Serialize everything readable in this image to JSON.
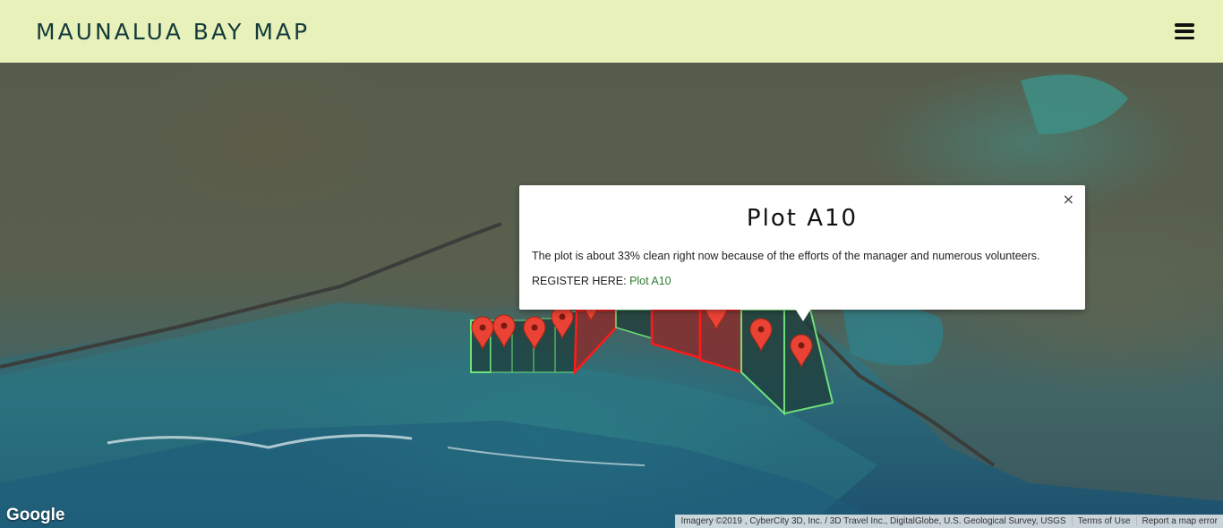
{
  "header": {
    "title": "MAUNALUA BAY MAP",
    "menu_icon": "hamburger-menu-icon"
  },
  "popup": {
    "title": "Plot A10",
    "close_symbol": "×",
    "description": "The plot is about 33% clean right now because of the efforts of the manager and numerous volunteers.",
    "register_label": "REGISTER HERE:",
    "register_link": "Plot A10"
  },
  "map": {
    "google_logo": "Google",
    "attribution": "Imagery ©2019 , CyberCity 3D, Inc. / 3D Travel Inc., DigitalGlobe, U.S. Geological Survey, USGS",
    "terms": "Terms of Use",
    "report": "Report a map error",
    "colors": {
      "header_bg": "#e8f1b9",
      "plot_border_green": "#6ee07a",
      "plot_border_red": "#ff1a1a",
      "marker_red": "#ea4335"
    }
  }
}
